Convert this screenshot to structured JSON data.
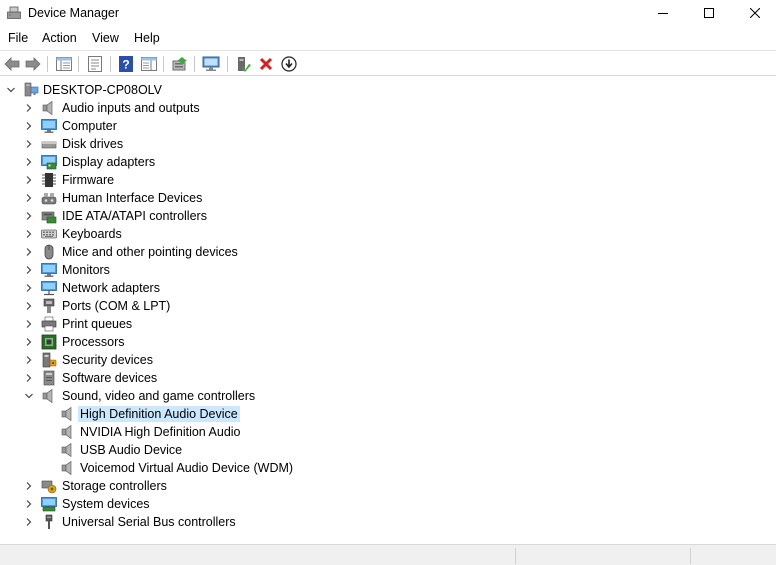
{
  "window": {
    "title": "Device Manager"
  },
  "window_buttons": {
    "minimize": "—",
    "maximize": "☐",
    "close": "✕"
  },
  "menu": {
    "items": [
      "File",
      "Action",
      "View",
      "Help"
    ]
  },
  "toolbar": {
    "buttons": [
      "back",
      "forward",
      "show-hide-console-tree",
      "properties",
      "help",
      "action-pane",
      "update-driver",
      "scan-for-hardware-changes",
      "enable-device",
      "uninstall-device",
      "disable-device"
    ]
  },
  "tree": {
    "root": "DESKTOP-CP08OLV",
    "categories": [
      {
        "label": "Audio inputs and outputs",
        "icon": "speaker-icon",
        "expanded": false
      },
      {
        "label": "Computer",
        "icon": "monitor-icon",
        "expanded": false
      },
      {
        "label": "Disk drives",
        "icon": "disk-drive-icon",
        "expanded": false
      },
      {
        "label": "Display adapters",
        "icon": "display-adapter-icon",
        "expanded": false
      },
      {
        "label": "Firmware",
        "icon": "chip-icon",
        "expanded": false
      },
      {
        "label": "Human Interface Devices",
        "icon": "hid-icon",
        "expanded": false
      },
      {
        "label": "IDE ATA/ATAPI controllers",
        "icon": "ide-controller-icon",
        "expanded": false
      },
      {
        "label": "Keyboards",
        "icon": "keyboard-icon",
        "expanded": false
      },
      {
        "label": "Mice and other pointing devices",
        "icon": "mouse-icon",
        "expanded": false
      },
      {
        "label": "Monitors",
        "icon": "monitor-icon",
        "expanded": false
      },
      {
        "label": "Network adapters",
        "icon": "network-adapter-icon",
        "expanded": false
      },
      {
        "label": "Ports (COM & LPT)",
        "icon": "port-icon",
        "expanded": false
      },
      {
        "label": "Print queues",
        "icon": "printer-icon",
        "expanded": false
      },
      {
        "label": "Processors",
        "icon": "processor-icon",
        "expanded": false
      },
      {
        "label": "Security devices",
        "icon": "security-device-icon",
        "expanded": false
      },
      {
        "label": "Software devices",
        "icon": "software-device-icon",
        "expanded": false
      },
      {
        "label": "Sound, video and game controllers",
        "icon": "speaker-icon",
        "expanded": true,
        "children": [
          {
            "label": "High Definition Audio Device",
            "icon": "speaker-icon",
            "selected": true
          },
          {
            "label": "NVIDIA High Definition Audio",
            "icon": "speaker-icon"
          },
          {
            "label": "USB Audio Device",
            "icon": "speaker-icon"
          },
          {
            "label": "Voicemod Virtual Audio Device (WDM)",
            "icon": "speaker-icon"
          }
        ]
      },
      {
        "label": "Storage controllers",
        "icon": "storage-controller-icon",
        "expanded": false
      },
      {
        "label": "System devices",
        "icon": "system-device-icon",
        "expanded": false
      },
      {
        "label": "Universal Serial Bus controllers",
        "icon": "usb-icon",
        "expanded": false
      }
    ]
  },
  "colors": {
    "selection": "#cce8ff",
    "accent": "#0078d4",
    "uninstall_red": "#d42020"
  }
}
